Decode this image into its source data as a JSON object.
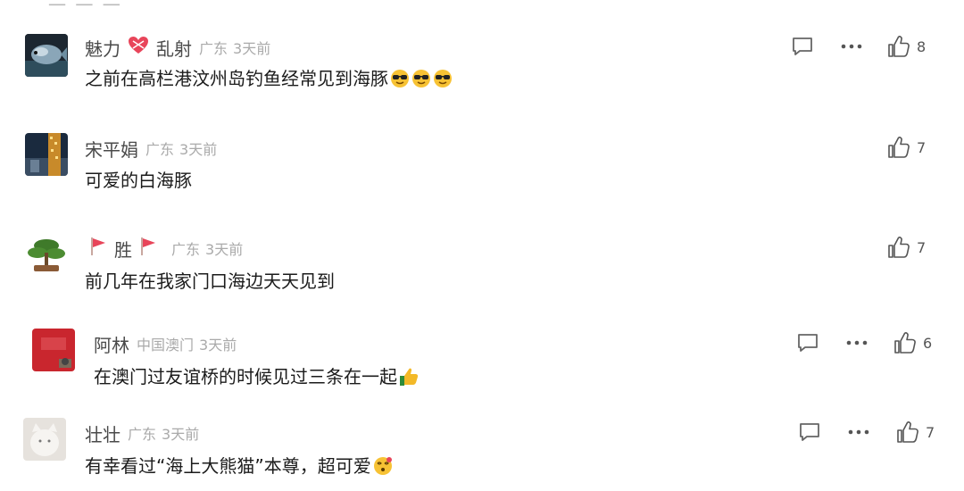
{
  "comments": [
    {
      "username": "魅力",
      "username_suffix": "乱射",
      "location": "广东",
      "time": "3天前",
      "text": "之前在高栏港汶州岛钓鱼经常见到海豚",
      "emoji": "sunglasses-face x3",
      "likes": "8",
      "has_reply": true,
      "has_more": true
    },
    {
      "username": "宋平娟",
      "location": "广东",
      "time": "3天前",
      "text": "可爱的白海豚",
      "likes": "7",
      "has_reply": false,
      "has_more": false
    },
    {
      "username": "胜",
      "location": "广东",
      "time": "3天前",
      "text": "前几年在我家门口海边天天见到",
      "likes": "7",
      "has_reply": false,
      "has_more": false
    },
    {
      "username": "阿林",
      "location": "中国澳门",
      "time": "3天前",
      "text": "在澳门过友谊桥的时候见过三条在一起",
      "emoji": "thumbs-up",
      "likes": "6",
      "has_reply": true,
      "has_more": true
    },
    {
      "username": "壮壮",
      "location": "广东",
      "time": "3天前",
      "text": "有幸看过“海上大熊猫”本尊，超可爱",
      "emoji": "dizzy-face",
      "likes": "7",
      "has_reply": true,
      "has_more": true
    }
  ],
  "icons": {
    "reply": "reply-icon",
    "more": "more-icon",
    "like": "like-icon"
  },
  "colors": {
    "username": "#4a4a4a",
    "meta": "#aaaaaa",
    "text": "#1b1b1b",
    "badge_red": "#e8455a"
  }
}
